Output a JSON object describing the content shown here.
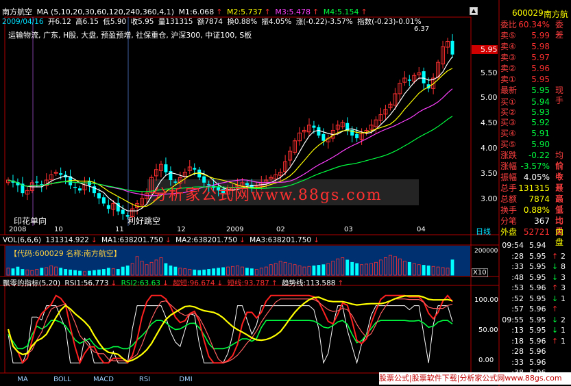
{
  "header": {
    "stock_name": "南方航空",
    "ma_label": "MA (5,10,20,30,60,120,240,360,4,1)",
    "m1": "M1:6.068",
    "m2": "M2:5.737",
    "m3": "M3:5.478",
    "m4": "M4:5.154",
    "date": "2009/04/16",
    "open": "开6.12",
    "high": "高6.15",
    "low": "低5.90",
    "close": "收5.95",
    "volume": "量131315",
    "amount": "额7874",
    "turnover": "换0.88%",
    "amplitude": "振4.05%",
    "change": "涨(-0.22)-3.57%",
    "index_change": "指数(-0.23)-0.01%",
    "concepts": "运输物流, 广东, H股, 大盘, 预盈预增, 社保重仓, 沪深300, 中证100, S板",
    "peak_label": "6.37",
    "current_price_tag": "5.95"
  },
  "annotations": {
    "a1": "印花单向",
    "a2": "利好跳空",
    "watermark": "分析家公式网www.88gs.com"
  },
  "x_axis": {
    "labels": [
      "2008",
      "10",
      "11",
      "12",
      "2009",
      "02",
      "03",
      "04"
    ],
    "right_label": "日线"
  },
  "price_axis": {
    "ticks": [
      "5.95",
      "5.50",
      "5.00",
      "4.50",
      "4.00",
      "3.50",
      "3.00"
    ]
  },
  "volume_panel": {
    "label": "VOL(6,6,6)",
    "vol": "131314.922",
    "ma1": "MA1:638201.750",
    "ma2": "MA2:638201.750",
    "ma3": "MA3:638201.750",
    "info": "【代码:600029 名称:南方航空】",
    "y_label": "200000",
    "scale": "X10"
  },
  "indicator_panel": {
    "title": "飘零的指标(5,20)",
    "rsi1": "RSI1:56.773",
    "rsi2": "RSI2:63.63",
    "chao_duan": "超短:96.674",
    "duan_xian": "短线:93.787",
    "trend": "趋势线:113.588",
    "y_ticks": [
      "100.00",
      "50.00",
      "0.00"
    ]
  },
  "tabs": [
    "MA",
    "BOLL",
    "MACD",
    "RSI",
    "DMI"
  ],
  "footer_banner": "股票公式|股票软件下载|分析家公式网www.88gs.com",
  "right_panel": {
    "code": "600029",
    "name": "南方航",
    "weibi_label": "委比",
    "weibi": "60.34%",
    "weicha_label": "委差",
    "sell": [
      {
        "label": "卖⑤",
        "price": "5.99"
      },
      {
        "label": "卖④",
        "price": "5.98"
      },
      {
        "label": "卖③",
        "price": "5.97"
      },
      {
        "label": "卖②",
        "price": "5.96"
      },
      {
        "label": "卖①",
        "price": "5.95"
      }
    ],
    "latest_label": "最新",
    "latest": "5.95",
    "latest_extra": "现手",
    "buy": [
      {
        "label": "买①",
        "price": "5.94"
      },
      {
        "label": "买②",
        "price": "5.93"
      },
      {
        "label": "买③",
        "price": "5.92"
      },
      {
        "label": "买④",
        "price": "5.91"
      },
      {
        "label": "买⑤",
        "price": "5.90"
      }
    ],
    "stats": [
      {
        "label": "涨跌",
        "value": "-0.22",
        "extra": "均价"
      },
      {
        "label": "涨幅",
        "value": "-3.57%",
        "extra": "前收"
      },
      {
        "label": "振幅",
        "value": "4.05%",
        "extra": "今开"
      },
      {
        "label": "总手",
        "value": "131315",
        "extra": "最高"
      },
      {
        "label": "总额",
        "value": "7874",
        "extra": "最低"
      },
      {
        "label": "换手",
        "value": "0.88%",
        "extra": "量比"
      },
      {
        "label": "分笔",
        "value": "367",
        "extra": "均量"
      }
    ],
    "outer_label": "外盘",
    "outer_value": "52721",
    "inner_label": "内盘",
    "ticks": [
      {
        "time": "09:54",
        "price": "5.94",
        "arrow": "",
        "vol": ""
      },
      {
        "time": ":28",
        "price": "5.95",
        "arrow": "↑",
        "vol": "2"
      },
      {
        "time": ":33",
        "price": "5.95",
        "arrow": "↓",
        "vol": "8"
      },
      {
        "time": ":48",
        "price": "5.95",
        "arrow": "↓",
        "vol": "3"
      },
      {
        "time": ":53",
        "price": "5.96",
        "arrow": "↑",
        "vol": "3"
      },
      {
        "time": ":52",
        "price": "5.95",
        "arrow": "↓",
        "vol": "1"
      },
      {
        "time": ":57",
        "price": "5.96",
        "arrow": "↑",
        "vol": ""
      },
      {
        "time": "09:55",
        "price": "5.95",
        "arrow": "↓",
        "vol": "2"
      },
      {
        "time": ":13",
        "price": "5.95",
        "arrow": "↓",
        "vol": "1"
      },
      {
        "time": ":18",
        "price": "5.96",
        "arrow": "↑",
        "vol": "1"
      },
      {
        "time": ":28",
        "price": "5.96",
        "arrow": "",
        "vol": ""
      },
      {
        "time": ":33",
        "price": "5.96",
        "arrow": "",
        "vol": ""
      },
      {
        "time": ":38",
        "price": "5.96",
        "arrow": "",
        "vol": ""
      }
    ]
  },
  "chart_data": {
    "type": "line",
    "description_source": "daily candlestick chart with moving averages, volume bars and RSI-style oscillator",
    "price_range": [
      2.7,
      6.6
    ],
    "current_price": 5.95,
    "peak_price": 6.37,
    "closes": [
      3.55,
      3.5,
      3.45,
      3.3,
      3.35,
      3.5,
      3.5,
      3.45,
      3.55,
      3.65,
      3.7,
      3.65,
      3.6,
      3.45,
      3.4,
      3.35,
      3.5,
      3.45,
      3.3,
      3.2,
      3.1,
      3.0,
      3.1,
      2.95,
      2.9,
      2.85,
      3.0,
      3.1,
      3.2,
      3.3,
      3.6,
      3.75,
      3.85,
      3.7,
      3.55,
      3.5,
      3.6,
      3.7,
      3.8,
      3.75,
      3.6,
      3.5,
      3.45,
      3.4,
      3.35,
      3.3,
      3.35,
      3.4,
      3.45,
      3.5,
      3.45,
      3.4,
      3.45,
      3.5,
      3.55,
      3.6,
      3.65,
      3.7,
      3.9,
      4.1,
      4.3,
      4.45,
      4.5,
      4.6,
      4.55,
      4.4,
      4.3,
      4.35,
      4.5,
      4.6,
      4.65,
      4.5,
      4.4,
      4.35,
      4.45,
      4.5,
      4.6,
      4.7,
      4.8,
      4.9,
      5.0,
      5.2,
      5.4,
      5.5,
      5.45,
      5.55,
      5.6,
      5.4,
      5.3,
      5.5,
      5.8,
      6.1,
      6.2,
      5.95
    ],
    "volume_values_scaled_x10": [
      60000,
      55000,
      70000,
      50000,
      45000,
      40000,
      50000,
      60000,
      65000,
      80000,
      70000,
      60000,
      50000,
      45000,
      40000,
      35000,
      30000,
      35000,
      40000,
      45000,
      50000,
      60000,
      55000,
      50000,
      70000,
      80000,
      100000,
      160000,
      120000,
      90000,
      110000,
      130000,
      150000,
      100000,
      80000,
      70000,
      60000,
      55000,
      50000,
      45000,
      40000,
      45000,
      50000,
      55000,
      60000,
      65000,
      70000,
      75000,
      80000,
      70000,
      60000,
      55000,
      50000,
      60000,
      70000,
      90000,
      100000,
      120000,
      110000,
      100000,
      90000,
      80000,
      70000,
      75000,
      80000,
      85000,
      90000,
      100000,
      120000,
      140000,
      150000,
      130000,
      110000,
      100000,
      90000,
      95000,
      100000,
      110000,
      130000,
      150000,
      170000,
      160000,
      140000,
      120000,
      110000,
      100000,
      90000,
      85000,
      80000,
      75000,
      70000,
      65000,
      60000,
      131314
    ],
    "series_names": [
      "RSI1",
      "RSI2",
      "超短",
      "短线",
      "趋势线"
    ],
    "indicator_range": [
      0,
      120
    ]
  }
}
